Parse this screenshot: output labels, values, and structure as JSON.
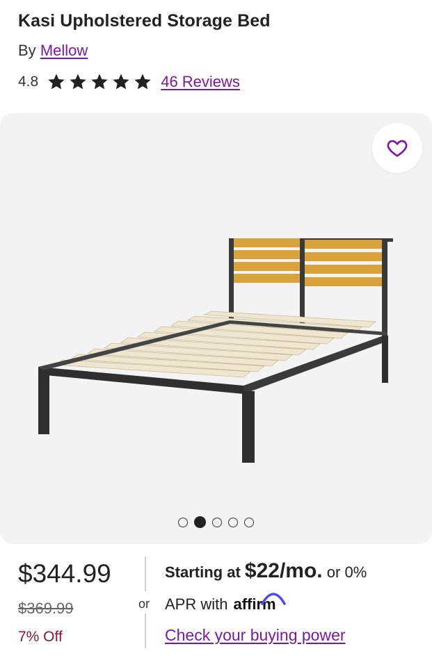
{
  "product": {
    "title": "Kasi Upholstered Storage Bed",
    "by_label": "By",
    "brand": "Mellow",
    "rating": "4.8",
    "stars": 5,
    "reviews_label": "46 Reviews"
  },
  "gallery": {
    "favorite_icon": "heart-icon",
    "image_count": 5,
    "active_index": 1
  },
  "pricing": {
    "price": "$344.99",
    "was_price": "$369.99",
    "discount": "7% Off",
    "or_label": "or",
    "starting_at": "Starting at",
    "monthly": "$22/mo.",
    "or_zero": "or 0%",
    "apr_with": "APR with",
    "affirm": "affirm",
    "check_link": "Check your buying power"
  },
  "colors": {
    "accent": "#7b189f",
    "discount": "#8a1538"
  }
}
